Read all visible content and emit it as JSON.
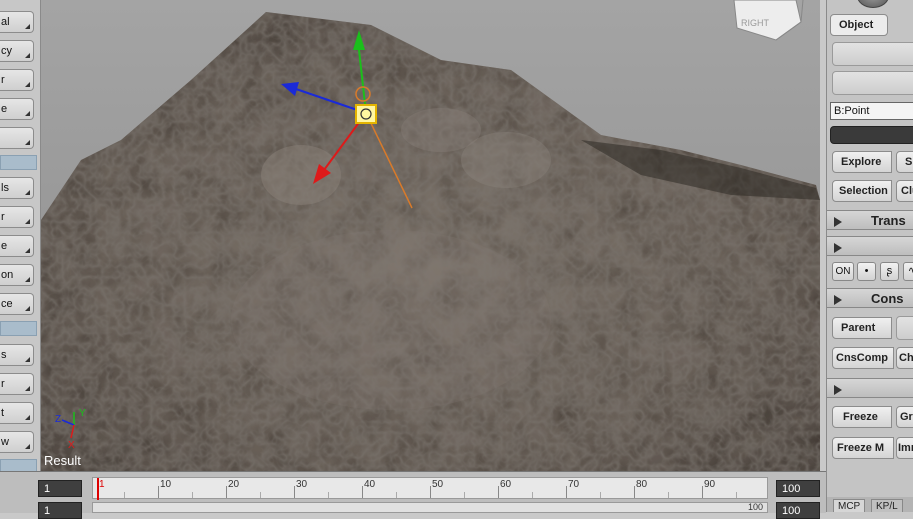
{
  "viewport": {
    "result_label": "Result",
    "cube_label": "RIGHT"
  },
  "left_toolbar": {
    "items": [
      {
        "label": "al"
      },
      {
        "label": "cy"
      },
      {
        "label": "r"
      },
      {
        "label": "e"
      },
      {
        "label": ""
      },
      {
        "label": "ls"
      },
      {
        "label": "r"
      },
      {
        "label": "e"
      },
      {
        "label": "on"
      },
      {
        "label": "ce"
      },
      {
        "label": "s"
      },
      {
        "label": "r"
      },
      {
        "label": "t"
      },
      {
        "label": "w"
      }
    ]
  },
  "timeline": {
    "start_frame": "1",
    "current_frame": "1",
    "end_frame": "100",
    "end_frame_2": "100",
    "range_end_label": "100",
    "ticks": [
      "1",
      "10",
      "20",
      "30",
      "40",
      "50",
      "60",
      "70",
      "80",
      "90"
    ]
  },
  "right_panel": {
    "object_button": "Object",
    "selection_field": "B:Point",
    "explore_button": "Explore",
    "explore_s": "S",
    "selection_button": "Selection",
    "clu_button": "Clu",
    "transform_header": "Trans",
    "on_button": "ON",
    "constrain_header": "Cons",
    "parent_button": "Parent",
    "cnscomp_button": "CnsComp",
    "chl_button": "Chl",
    "freeze_button": "Freeze",
    "gr_button": "Gr",
    "freeze_m_button": "Freeze M",
    "imm_button": "Imm",
    "tab_mcp": "MCP",
    "tab_kp": "KP/L"
  },
  "colors": {
    "viewport_bg": "#9a9a9a",
    "x_axis": "#dd1a1a",
    "y_axis": "#1bbf1b",
    "z_axis": "#1a2ad8",
    "selection_accent": "#a9bccb"
  }
}
